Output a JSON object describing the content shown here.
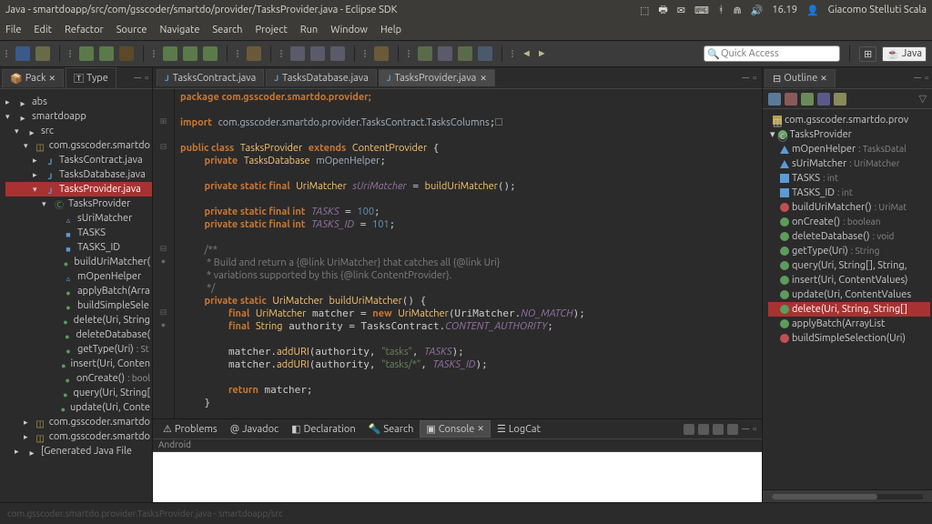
{
  "top": {
    "title": "Java - smartdoapp/src/com/gsscoder/smartdo/provider/TasksProvider.java - Eclipse SDK",
    "tray": {
      "time": "16.19",
      "user": "Giacomo Stelluti Scala"
    }
  },
  "menu": [
    "File",
    "Edit",
    "Refactor",
    "Source",
    "Navigate",
    "Search",
    "Project",
    "Run",
    "Window",
    "Help"
  ],
  "quick_access_placeholder": "Quick Access",
  "perspective_java": "Java",
  "left_panel": {
    "tabs": [
      "Pack",
      "Type"
    ],
    "tree": [
      {
        "lvl": 1,
        "tw": "▸",
        "icon": "ic-folder",
        "label": "abs"
      },
      {
        "lvl": 1,
        "tw": "▾",
        "icon": "ic-folder",
        "label": "smartdoapp"
      },
      {
        "lvl": 2,
        "tw": "▾",
        "icon": "ic-folder",
        "label": "src"
      },
      {
        "lvl": 3,
        "tw": "▾",
        "icon": "ic-pkg",
        "label": "com.gsscoder.smartdo"
      },
      {
        "lvl": 4,
        "tw": "▸",
        "icon": "ic-j",
        "label": "TasksContract.java"
      },
      {
        "lvl": 4,
        "tw": "▸",
        "icon": "ic-j",
        "label": "TasksDatabase.java"
      },
      {
        "lvl": 4,
        "tw": "▾",
        "icon": "ic-j",
        "label": "TasksProvider.java",
        "selected": true
      },
      {
        "lvl": 5,
        "tw": "▾",
        "icon": "ic-class",
        "label": "TasksProvider"
      },
      {
        "lvl": 6,
        "tw": "",
        "icon": "ic-field",
        "label": "sUriMatcher"
      },
      {
        "lvl": 6,
        "tw": "",
        "icon": "ic-sf",
        "label": "TASKS"
      },
      {
        "lvl": 6,
        "tw": "",
        "icon": "ic-sf",
        "label": "TASKS_ID"
      },
      {
        "lvl": 6,
        "tw": "",
        "icon": "ic-meth",
        "label": "buildUriMatcher("
      },
      {
        "lvl": 6,
        "tw": "",
        "icon": "ic-field",
        "label": "mOpenHelper"
      },
      {
        "lvl": 6,
        "tw": "",
        "icon": "ic-meth",
        "label": "applyBatch(Arra"
      },
      {
        "lvl": 6,
        "tw": "",
        "icon": "ic-meth",
        "label": "buildSimpleSele"
      },
      {
        "lvl": 6,
        "tw": "",
        "icon": "ic-meth",
        "label": "delete(Uri, String"
      },
      {
        "lvl": 6,
        "tw": "",
        "icon": "ic-meth",
        "label": "deleteDatabase("
      },
      {
        "lvl": 6,
        "tw": "",
        "icon": "ic-meth",
        "label": "getType(Uri)",
        "type": ": St"
      },
      {
        "lvl": 6,
        "tw": "",
        "icon": "ic-meth",
        "label": "insert(Uri, Conten"
      },
      {
        "lvl": 6,
        "tw": "",
        "icon": "ic-meth",
        "label": "onCreate()",
        "type": ": bool"
      },
      {
        "lvl": 6,
        "tw": "",
        "icon": "ic-meth",
        "label": "query(Uri, String["
      },
      {
        "lvl": 6,
        "tw": "",
        "icon": "ic-meth",
        "label": "update(Uri, Conte"
      },
      {
        "lvl": 3,
        "tw": "▸",
        "icon": "ic-pkg",
        "label": "com.gsscoder.smartdo"
      },
      {
        "lvl": 3,
        "tw": "▸",
        "icon": "ic-pkg",
        "label": "com.gsscoder.smartdo"
      },
      {
        "lvl": 2,
        "tw": "▸",
        "icon": "ic-folder",
        "label": "[Generated Java File"
      }
    ]
  },
  "editor_tabs": [
    {
      "label": "TasksContract.java",
      "active": false
    },
    {
      "label": "TasksDatabase.java",
      "active": false
    },
    {
      "label": "TasksProvider.java",
      "active": true
    }
  ],
  "code": {
    "pkg": "package com.gsscoder.smartdo.provider;",
    "imp": "import com.gsscoder.smartdo.provider.TasksContract.TasksColumns;",
    "class_decl": {
      "p1": "public class",
      "name": "TasksProvider",
      "ext": "extends",
      "base": "ContentProvider"
    },
    "mOpenHelper": {
      "mod": "private",
      "type": "TasksDatabase",
      "name": "mOpenHelper;"
    },
    "sUriMatcher": {
      "mod": "private static final",
      "type": "UriMatcher",
      "name": "sUriMatcher",
      "init": "buildUriMatcher();"
    },
    "tasks": {
      "mod": "private static final int",
      "name": "TASKS",
      "val": "100"
    },
    "tasks_id": {
      "mod": "private static final int",
      "name": "TASKS_ID",
      "val": "101"
    },
    "cmt1": "/**",
    "cmt2": " * Build and return a {@link UriMatcher} that catches all {@link Uri}",
    "cmt3": " * variations supported by this {@link ContentProvider}.",
    "cmt4": " */",
    "build_decl": {
      "mod": "private static",
      "type": "UriMatcher",
      "name": "buildUriMatcher()"
    },
    "matcher_line": {
      "kw": "final",
      "type": "UriMatcher",
      "var": "matcher",
      "eq": "=",
      "new": "new",
      "type2": "UriMatcher",
      "arg": "UriMatcher.NO_MATCH"
    },
    "auth_line": {
      "kw": "final",
      "type": "String",
      "var": "authority",
      "eq": "=",
      "val": "TasksContract.CONTENT_AUTHORITY"
    },
    "add1": {
      "call": "matcher.addURI",
      "a1": "authority",
      "a2": "\"tasks\"",
      "a3": "TASKS"
    },
    "add2": {
      "call": "matcher.addURI",
      "a1": "authority",
      "a2": "\"tasks/*\"",
      "a3": "TASKS_ID"
    },
    "ret": "return matcher;"
  },
  "bottom_tabs": [
    {
      "label": "Problems",
      "icon": "⚠"
    },
    {
      "label": "Javadoc",
      "icon": "@"
    },
    {
      "label": "Declaration",
      "icon": "⌘"
    },
    {
      "label": "Search",
      "icon": "🔍"
    },
    {
      "label": "Console",
      "icon": "▣",
      "active": true
    },
    {
      "label": "LogCat",
      "icon": "☰"
    }
  ],
  "bottom_header": "Android",
  "outline": {
    "tab": "Outline",
    "tree": [
      {
        "lvl": 1,
        "icon": "pkg",
        "label": "com.gsscoder.smartdo.prov"
      },
      {
        "lvl": 1,
        "tw": "▾",
        "icon": "class",
        "label": "TasksProvider"
      },
      {
        "lvl": 2,
        "icon": "tri",
        "label": "mOpenHelper",
        "type": ": TasksDatal"
      },
      {
        "lvl": 2,
        "icon": "tri",
        "label": "sUriMatcher",
        "type": ": UriMatcher"
      },
      {
        "lvl": 2,
        "icon": "sq",
        "label": "TASKS",
        "type": ": int"
      },
      {
        "lvl": 2,
        "icon": "sq",
        "label": "TASKS_ID",
        "type": ": int"
      },
      {
        "lvl": 2,
        "icon": "red",
        "label": "buildUriMatcher()",
        "type": ": UriMat"
      },
      {
        "lvl": 2,
        "icon": "green",
        "label": "onCreate()",
        "type": ": boolean"
      },
      {
        "lvl": 2,
        "icon": "green",
        "label": "deleteDatabase()",
        "type": ": void"
      },
      {
        "lvl": 2,
        "icon": "green",
        "label": "getType(Uri)",
        "type": ": String"
      },
      {
        "lvl": 2,
        "icon": "green",
        "label": "query(Uri, String[], String,"
      },
      {
        "lvl": 2,
        "icon": "green",
        "label": "insert(Uri, ContentValues)"
      },
      {
        "lvl": 2,
        "icon": "green",
        "label": "update(Uri, ContentValues"
      },
      {
        "lvl": 2,
        "icon": "green",
        "label": "delete(Uri, String, String[]",
        "selected": true
      },
      {
        "lvl": 2,
        "icon": "green",
        "label": "applyBatch(ArrayList<Con"
      },
      {
        "lvl": 2,
        "icon": "red",
        "label": "buildSimpleSelection(Uri)"
      }
    ]
  },
  "status": "com.gsscoder.smartdo.provider.TasksProvider.java - smartdoapp/src"
}
